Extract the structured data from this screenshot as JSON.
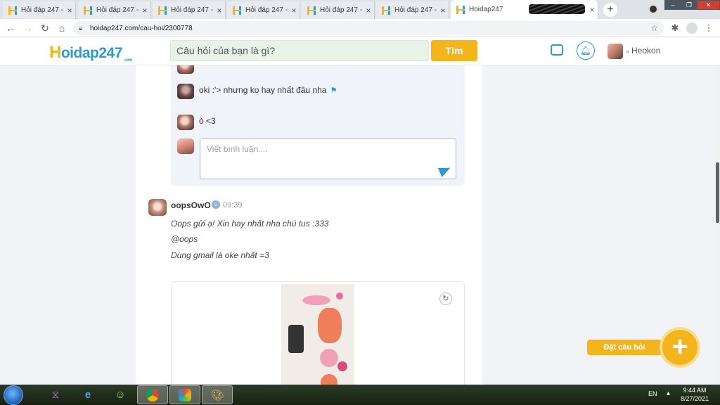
{
  "browser": {
    "tabs": [
      {
        "title": "Hỏi đáp 247 -"
      },
      {
        "title": "Hỏi đáp 247 -"
      },
      {
        "title": "Hỏi đáp 247 -"
      },
      {
        "title": "Hỏi đáp 247 -"
      },
      {
        "title": "Hỏi đáp 247 -"
      },
      {
        "title": "Hỏi đáp 247 -"
      },
      {
        "title": "Hoidap247"
      }
    ],
    "new_tab": "+",
    "url": "hoidap247.com/cau-hoi/2300778"
  },
  "site": {
    "logo_h": "H",
    "logo_rest": "oidap247",
    "logo_suffix": ".com",
    "search_placeholder": "Câu hỏi của bạn là gì?",
    "search_button": "Tìm",
    "username": "Heokon"
  },
  "comments": [
    {
      "text": "oki :'> nhưng ko hay nhất đâu nha"
    },
    {
      "text": "ò <3"
    }
  ],
  "comment_input_placeholder": "Viết bình luận....",
  "answer": {
    "author": "oopsOwO",
    "time": "09:39",
    "lines": [
      "Oops gửi ạ! Xin hay nhất nha chú tus :333",
      "@oops",
      "Dùng gmail là oke nhất =3"
    ]
  },
  "fab": {
    "label": "Đặt câu hỏi"
  },
  "taskbar": {
    "language": "EN",
    "time": "9:44 AM",
    "date": "8/27/2021"
  },
  "colors": {
    "brand_yellow": "#f3b51b",
    "brand_blue": "#2d9bd2"
  }
}
